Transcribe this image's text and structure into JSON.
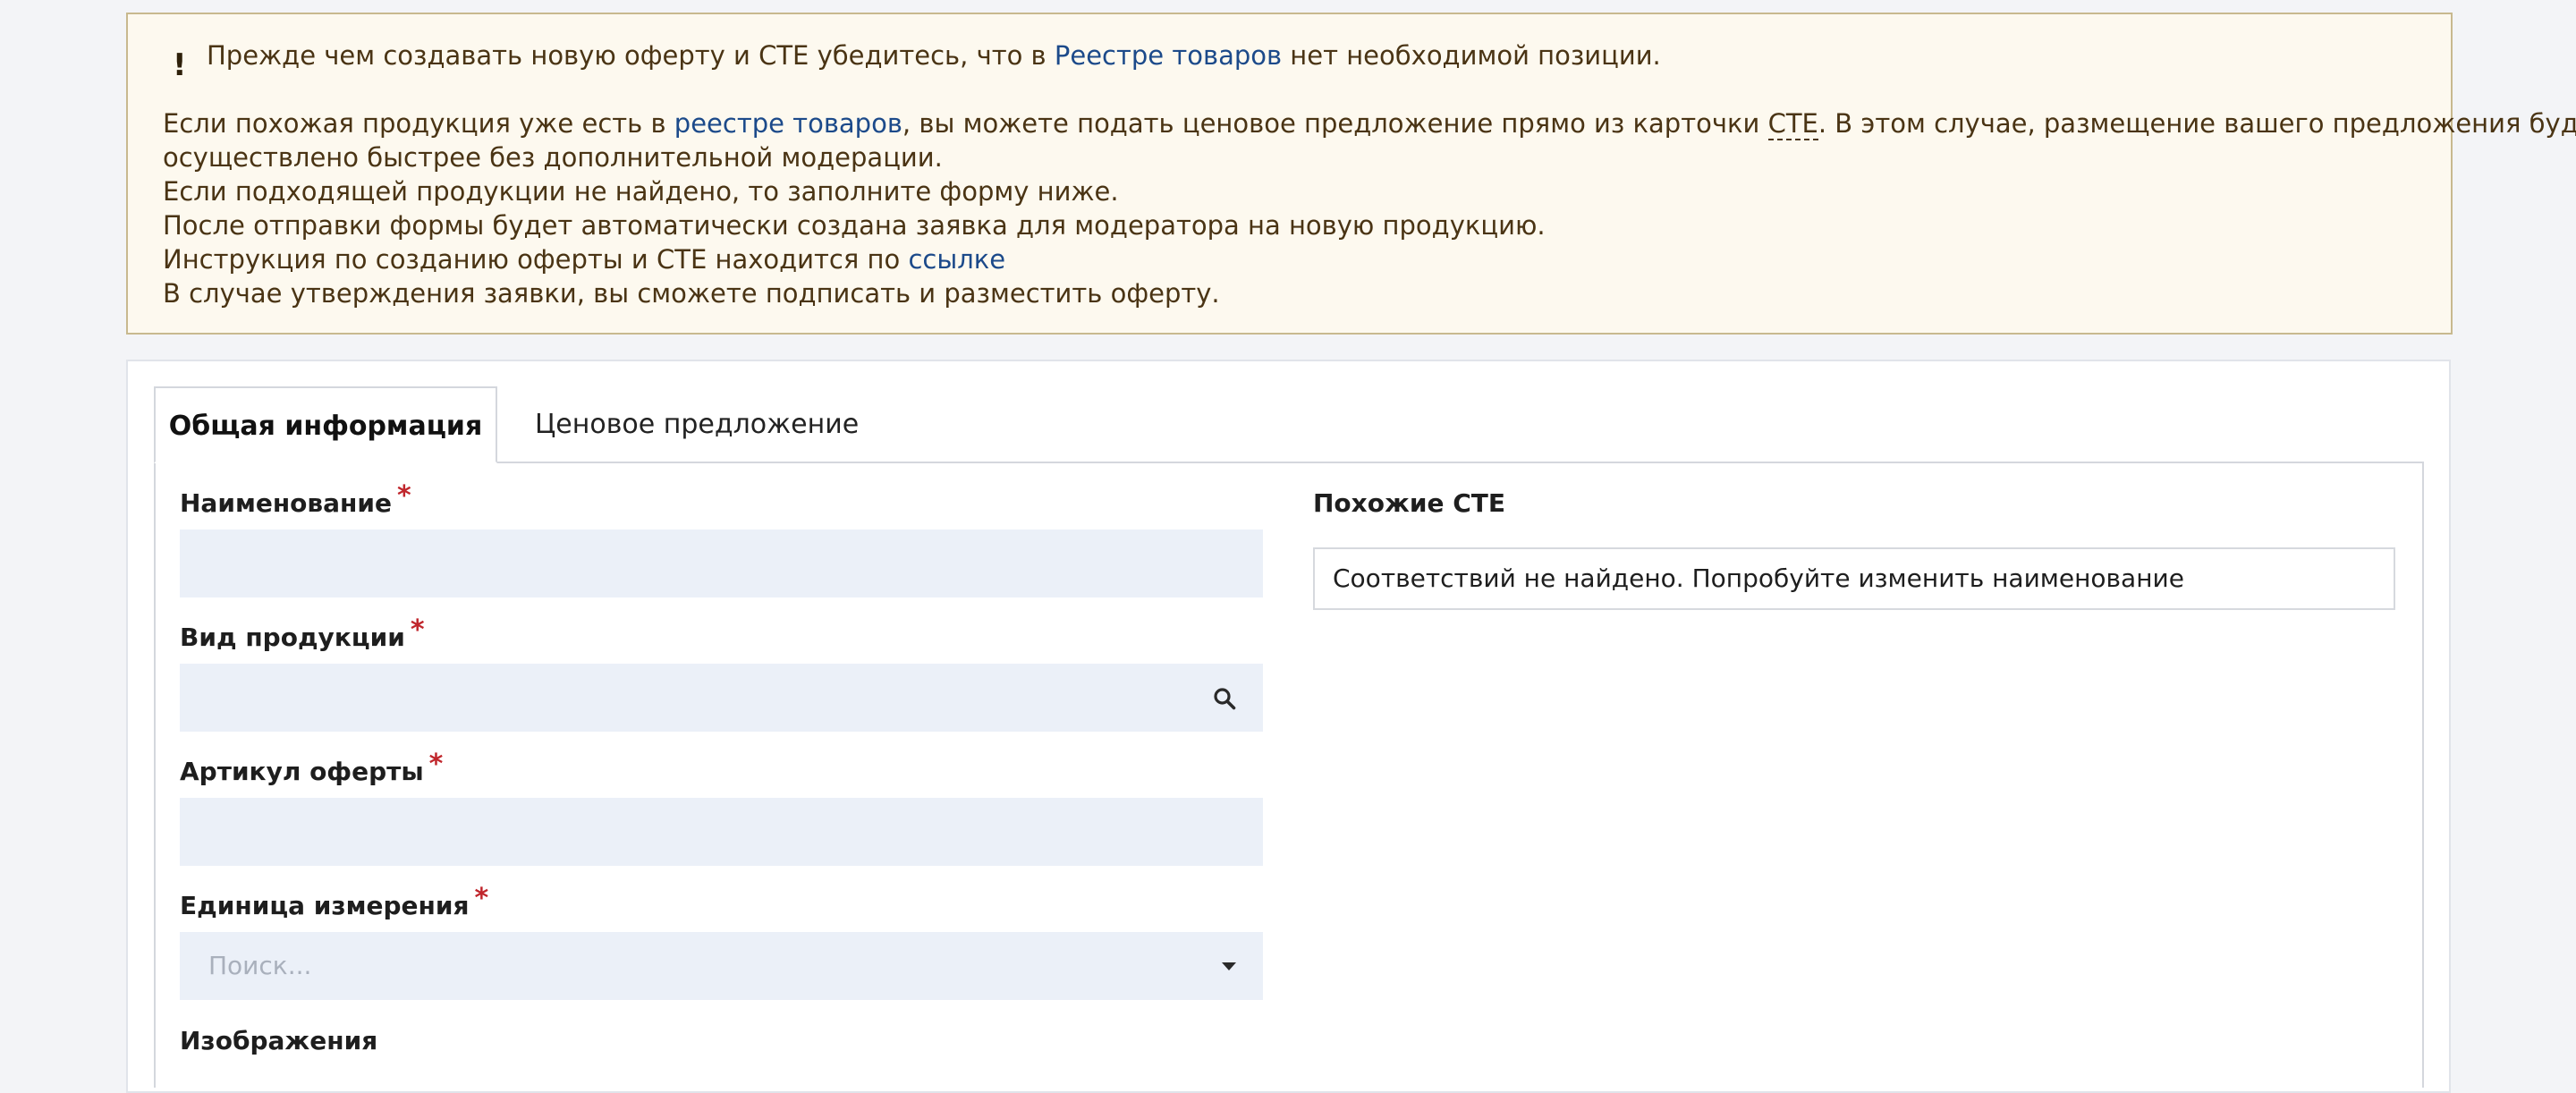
{
  "notice": {
    "line1_pre": "Прежде чем создавать новую оферту и СТЕ убедитесь, что в ",
    "line1_link": "Реестре товаров",
    "line1_post": " нет необходимой позиции.",
    "line2_pre": "Если похожая продукция уже есть в ",
    "line2_link": "реестре товаров",
    "line2_mid": ", вы можете подать ценовое предложение прямо из карточки ",
    "line2_abbr": "СТЕ",
    "line2_post": ". В этом случае, размещение вашего предложения будет",
    "line3": "осуществлено быстрее без дополнительной модерации.",
    "line4": "Если подходящей продукции не найдено, то заполните форму ниже.",
    "line5": "После отправки формы будет автоматически создана заявка для модератора на новую продукцию.",
    "line6_pre": "Инструкция по созданию оферты и СТЕ находится по ",
    "line6_link": "ссылке",
    "line7": "В случае утверждения заявки, вы сможете подписать и разместить оферту.",
    "icon": "exclamation-icon"
  },
  "tabs": [
    {
      "label": "Общая информация",
      "active": true
    },
    {
      "label": "Ценовое предложение",
      "active": false
    }
  ],
  "form": {
    "name_label": "Наименование",
    "product_type_label": "Вид продукции",
    "article_label": "Артикул оферты",
    "unit_label": "Единица измерения",
    "unit_placeholder": "Поиск...",
    "images_label": "Изображения",
    "required_mark": "*"
  },
  "similar": {
    "title": "Похожие СТЕ",
    "empty_text": "Соответствий не найдено. Попробуйте изменить наименование"
  },
  "colors": {
    "notice_bg": "#fdf9ef",
    "notice_border": "#c8b98f",
    "link": "#1c4a8a",
    "required": "#c0262c",
    "field_bg": "#ebf0f8"
  }
}
